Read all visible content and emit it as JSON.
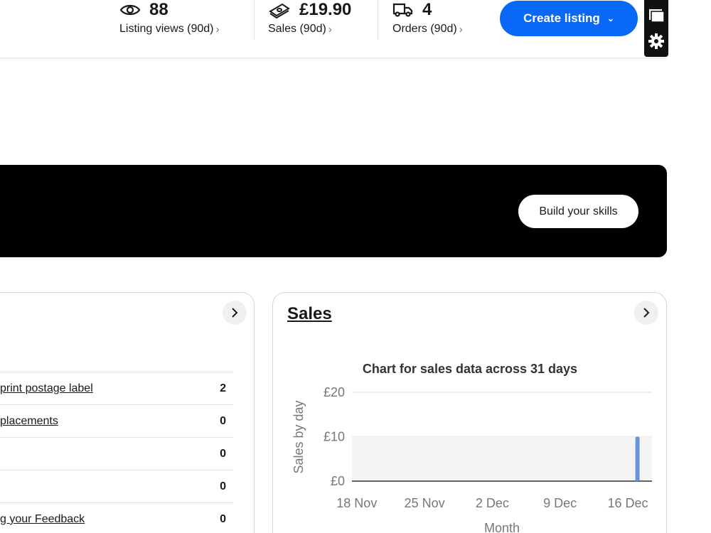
{
  "stats": {
    "views": {
      "value": "88",
      "label": "Listing views (90d)",
      "icon": "eye-icon"
    },
    "sales": {
      "value": "£19.90",
      "label": "Sales (90d)",
      "icon": "money-icon"
    },
    "orders": {
      "value": "4",
      "label": "Orders (90d)",
      "icon": "truck-icon"
    }
  },
  "create_button_label": "Create listing",
  "banner": {
    "button_label": "Build your skills"
  },
  "tasks": [
    {
      "name": "print postage label",
      "count": "2"
    },
    {
      "name": "placements",
      "count": "0"
    },
    {
      "name": "",
      "count": "0"
    },
    {
      "name": "",
      "count": "0"
    },
    {
      "name": "g your Feedback",
      "count": "0"
    }
  ],
  "sales_card": {
    "title": "Sales"
  },
  "chart_data": {
    "type": "bar",
    "title": "Chart for sales data across 31 days",
    "xlabel": "Month",
    "ylabel": "Sales by day",
    "y_ticks": [
      "£0",
      "£10",
      "£20"
    ],
    "ylim": [
      0,
      20
    ],
    "x_ticks": [
      "18 Nov",
      "25 Nov",
      "2 Dec",
      "9 Dec",
      "16 Dec"
    ],
    "days": 31,
    "start_day": "18 Nov",
    "bars": [
      {
        "day": "17 Dec",
        "value": 10
      }
    ],
    "bar_color": "#6a95d8",
    "grid": true
  },
  "colors": {
    "accent": "#0968f6"
  }
}
